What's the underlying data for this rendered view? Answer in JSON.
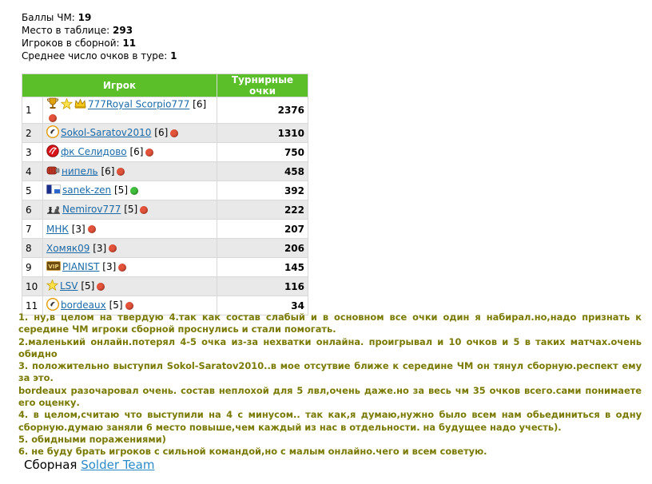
{
  "stats": [
    {
      "label": "Баллы ЧМ:",
      "value": "19"
    },
    {
      "label": "Место в таблице:",
      "value": "293"
    },
    {
      "label": "Игроков в сборной:",
      "value": "11"
    },
    {
      "label": "Среднее число очков в туре:",
      "value": "1"
    }
  ],
  "table": {
    "headers": {
      "player": "Игрок",
      "points": "Турнирные очки"
    },
    "rows": [
      {
        "rank": "1",
        "name": "777Royal Scorpio777",
        "level": "[6]",
        "status": "red",
        "points": "2376",
        "icons": [
          "trophy-icon",
          "star-icon",
          "crown-icon"
        ]
      },
      {
        "rank": "2",
        "name": "Sokol-Saratov2010",
        "level": "[6]",
        "status": "red",
        "points": "1310",
        "icons": [
          "club-logo-icon"
        ]
      },
      {
        "rank": "3",
        "name": "фк Селидово",
        "level": "[6]",
        "status": "red",
        "points": "750",
        "icons": [
          "red-ball-icon"
        ]
      },
      {
        "rank": "4",
        "name": "нипель",
        "level": "[6]",
        "status": "red",
        "points": "458",
        "icons": [
          "boxing-glove-icon"
        ]
      },
      {
        "rank": "5",
        "name": "sanek-zen",
        "level": "[5]",
        "status": "green",
        "points": "392",
        "icons": [
          "flag-icon"
        ]
      },
      {
        "rank": "6",
        "name": "Nemirov777",
        "level": "[5]",
        "status": "red",
        "points": "222",
        "icons": [
          "chess-icon"
        ]
      },
      {
        "rank": "7",
        "name": "МНК",
        "level": "[3]",
        "status": "red",
        "points": "207",
        "icons": []
      },
      {
        "rank": "8",
        "name": "Хомяк09",
        "level": "[3]",
        "status": "red",
        "points": "206",
        "icons": []
      },
      {
        "rank": "9",
        "name": "PIANIST",
        "level": "[3]",
        "status": "red",
        "points": "145",
        "icons": [
          "vip-badge-icon"
        ]
      },
      {
        "rank": "10",
        "name": "LSV",
        "level": "[5]",
        "status": "red",
        "points": "116",
        "icons": [
          "star-icon"
        ]
      },
      {
        "rank": "11",
        "name": "bordeaux",
        "level": "[5]",
        "status": "red",
        "points": "34",
        "icons": [
          "club-logo-icon"
        ]
      }
    ]
  },
  "review": [
    "1. ну,в целом на твердую 4.так как состав слабый и в основном все очки один я набирал.но,надо признать к середине ЧМ игроки сборной проснулись и стали помогать.",
    "2.маленький онлайн.потерял 4-5 очка из-за нехватки онлайна. проигрывал и 10 очков и 5 в таких матчах.очень обидно",
    "3. положительно выступил Sokol-Saratov2010..в мое отсутвие ближе к середине ЧМ он тянул сборную.респект ему за это.",
    "bordeaux разочаровал очень. состав неплохой для 5 лвл,очень даже.но за весь чм 35 очков всего.сами понимаете его оценку.",
    "4. в целом,считаю что выступили на 4 с минусом.. так как,я думаю,нужно было всем нам обьединиться в одну сборную.думаю заняли 6 место повыше,чем каждый из нас в отдельности. на будущее надо учесть).",
    "5. обидными поражениями)",
    "6. не буду брать игроков с сильной командой,но с малым онлайно.чего и всем советую."
  ],
  "footer": {
    "label": "Сборная",
    "team": "Solder Team"
  },
  "colors": {
    "header_green": "#5bbf29",
    "link": "#1c6aa8",
    "review_text": "#7a7a00",
    "status_red": "#e5533a",
    "status_green": "#3fbf3a"
  }
}
